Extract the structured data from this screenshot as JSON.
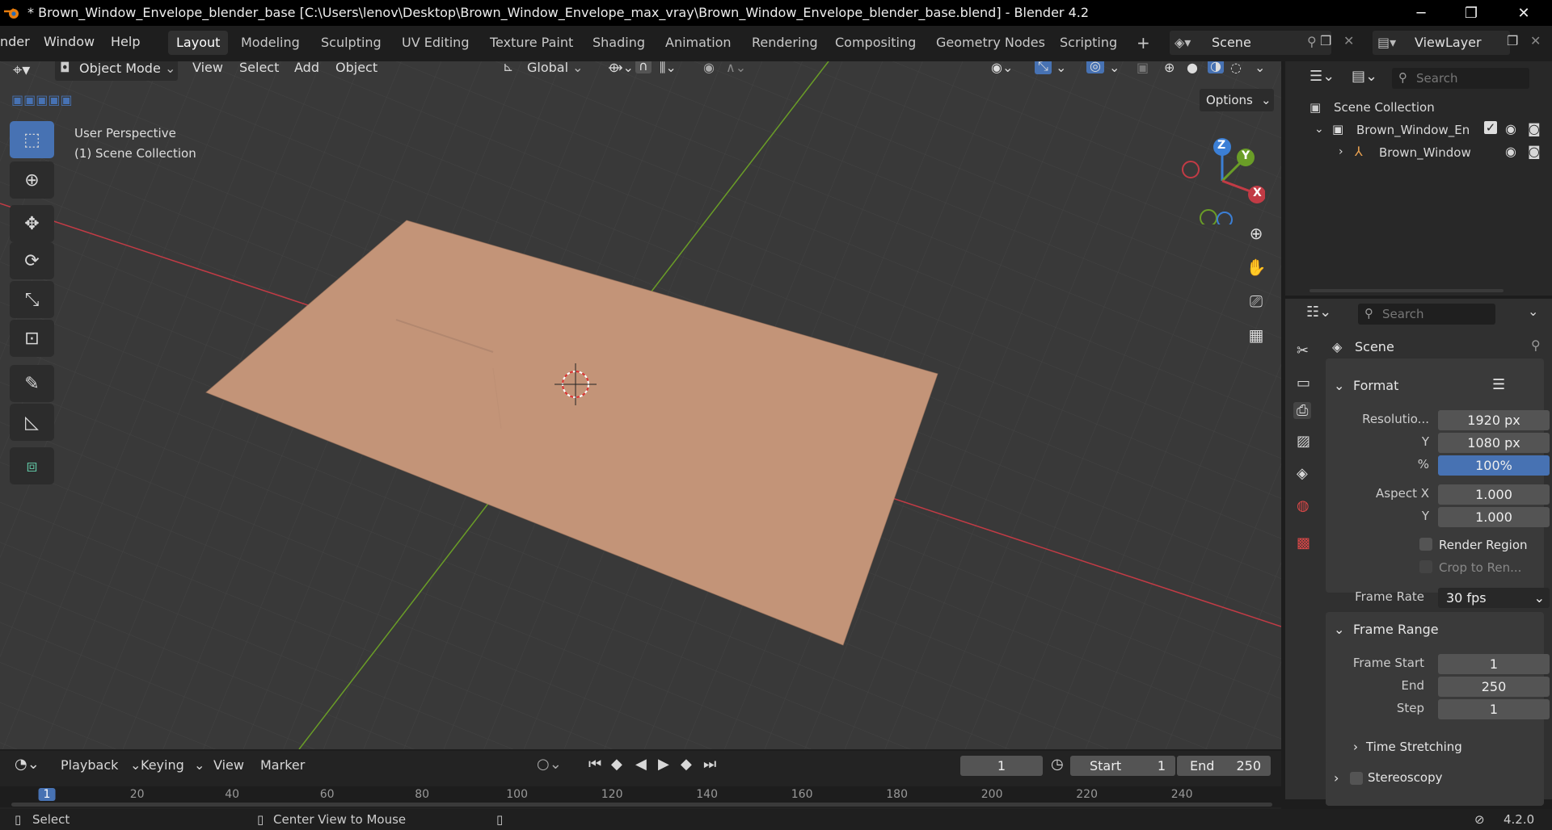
{
  "window": {
    "title": "* Brown_Window_Envelope_blender_base [C:\\Users\\lenov\\Desktop\\Brown_Window_Envelope_max_vray\\Brown_Window_Envelope_blender_base.blend] - Blender 4.2",
    "minimize": "─",
    "maximize": "❐",
    "close": "✕"
  },
  "menubar": {
    "items": [
      "nder",
      "Window",
      "Help"
    ]
  },
  "workspaces": [
    "Layout",
    "Modeling",
    "Sculpting",
    "UV Editing",
    "Texture Paint",
    "Shading",
    "Animation",
    "Rendering",
    "Compositing",
    "Geometry Nodes",
    "Scripting"
  ],
  "add_workspace": "+",
  "scene_field": "Scene",
  "viewlayer_field": "ViewLayer",
  "viewport_header": {
    "mode": "Object Mode",
    "menus": [
      "View",
      "Select",
      "Add",
      "Object"
    ],
    "orientation": "Global",
    "options_label": "Options"
  },
  "viewport_overlay": {
    "perspective": "User Perspective",
    "collection": "(1) Scene Collection"
  },
  "gizmo": {
    "z": "Z",
    "y": "Y",
    "x": "X"
  },
  "outliner": {
    "search_placeholder": "Search",
    "root": "Scene Collection",
    "collection": "Brown_Window_En",
    "object": "Brown_Window"
  },
  "properties": {
    "search_placeholder": "Search",
    "context": "Scene",
    "format": {
      "header": "Format",
      "resolution_label": "Resolutio...",
      "res_x": "1920 px",
      "y_label": "Y",
      "res_y": "1080 px",
      "pct_label": "%",
      "pct": "100%",
      "aspect_x_label": "Aspect X",
      "aspect_x": "1.000",
      "aspect_y_label": "Y",
      "aspect_y": "1.000",
      "render_region": "Render Region",
      "crop": "Crop to Ren...",
      "frame_rate_label": "Frame Rate",
      "frame_rate": "30 fps"
    },
    "frame_range": {
      "header": "Frame Range",
      "start_label": "Frame Start",
      "start": "1",
      "end_label": "End",
      "end": "250",
      "step_label": "Step",
      "step": "1"
    },
    "time_stretching": "Time Stretching",
    "stereoscopy": "Stereoscopy"
  },
  "timeline": {
    "menus": [
      "Playback",
      "Keying",
      "View",
      "Marker"
    ],
    "current_frame": "1",
    "start_label": "Start",
    "start": "1",
    "end_label": "End",
    "end": "250",
    "ticks": [
      "1",
      "20",
      "40",
      "60",
      "80",
      "100",
      "120",
      "140",
      "160",
      "180",
      "200",
      "220",
      "240"
    ]
  },
  "statusbar": {
    "select": "Select",
    "center": "Center View to Mouse",
    "version": "4.2.0"
  },
  "colors": {
    "accent": "#4772b3",
    "x_axis": "#c23b45",
    "y_axis": "#6a9d27",
    "envelope": "#c39478",
    "grid_bg": "#393939"
  }
}
